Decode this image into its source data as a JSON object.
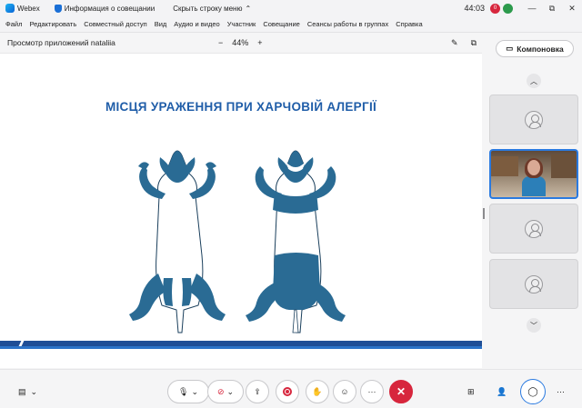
{
  "app": {
    "name": "Webex",
    "meeting_info": "Информация о совещании",
    "hide_menu": "Скрыть строку меню"
  },
  "timer": "44:03",
  "badge_count": "0",
  "window_controls": [
    "—",
    "⧉",
    "✕"
  ],
  "menu": [
    "Файл",
    "Редактировать",
    "Совместный доступ",
    "Вид",
    "Аудио и видео",
    "Участник",
    "Совещание",
    "Сеансы работы в группах",
    "Справка"
  ],
  "share": {
    "title": "Просмотр приложений nataliia",
    "zoom_minus": "−",
    "zoom": "44%",
    "zoom_plus": "+"
  },
  "slide": {
    "title": "МІСЦЯ УРАЖЕННЯ ПРИ ХАРЧОВІЙ АЛЕРГІЇ"
  },
  "sidebar": {
    "layout_label": "Компоновка",
    "up": "︿",
    "down": "﹀"
  },
  "colors": {
    "accent": "#2a7ae0",
    "slide_blue": "#2a6b94",
    "title_blue": "#1f5da8",
    "danger": "#d7263d"
  },
  "bottombar": {
    "chevron": "⌄",
    "more": "···",
    "end": "✕"
  }
}
